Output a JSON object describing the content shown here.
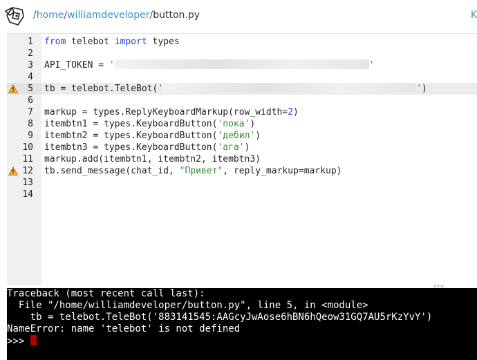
{
  "header": {
    "path_prefix": "/",
    "path_home": "home",
    "path_sep1": "/",
    "path_user": "williamdeveloper",
    "path_sep2": "/",
    "path_file": "button.py",
    "corner_letter": "K"
  },
  "editor": {
    "lines": [
      {
        "n": "1",
        "parts": [
          {
            "t": "from",
            "c": "kw"
          },
          {
            "t": " telebot ",
            "c": ""
          },
          {
            "t": "import",
            "c": "kw"
          },
          {
            "t": " types",
            "c": ""
          }
        ]
      },
      {
        "n": "2",
        "parts": []
      },
      {
        "n": "3",
        "parts": [
          {
            "t": "API_TOKEN = ",
            "c": ""
          },
          {
            "t": "'",
            "c": "str"
          },
          {
            "t": "[redacted]",
            "c": "redact",
            "w": 368
          },
          {
            "t": "'",
            "c": "str"
          }
        ]
      },
      {
        "n": "4",
        "parts": []
      },
      {
        "n": "5",
        "warn": true,
        "highlight": true,
        "parts": [
          {
            "t": "tb = telebot.TeleBot(",
            "c": ""
          },
          {
            "t": "'",
            "c": "str"
          },
          {
            "t": "[redacted]",
            "c": "redact",
            "w": 366
          },
          {
            "t": "'",
            "c": "str"
          },
          {
            "t": ")",
            "c": ""
          }
        ]
      },
      {
        "n": "6",
        "parts": []
      },
      {
        "n": "7",
        "parts": [
          {
            "t": "markup = types.ReplyKeyboardMarkup(row_width=",
            "c": ""
          },
          {
            "t": "2",
            "c": "num-lit"
          },
          {
            "t": ")",
            "c": ""
          }
        ]
      },
      {
        "n": "8",
        "parts": [
          {
            "t": "itembtn1 = types.KeyboardButton(",
            "c": ""
          },
          {
            "t": "'пока'",
            "c": "str"
          },
          {
            "t": ")",
            "c": ""
          }
        ]
      },
      {
        "n": "9",
        "parts": [
          {
            "t": "itembtn2 = types.KeyboardButton(",
            "c": ""
          },
          {
            "t": "'дебил'",
            "c": "str"
          },
          {
            "t": ")",
            "c": ""
          }
        ]
      },
      {
        "n": "10",
        "parts": [
          {
            "t": "itembtn3 = types.KeyboardButton(",
            "c": ""
          },
          {
            "t": "'ага'",
            "c": "str"
          },
          {
            "t": ")",
            "c": ""
          }
        ]
      },
      {
        "n": "11",
        "parts": [
          {
            "t": "markup.add(itembtn1, itembtn2, itembtn3)",
            "c": ""
          }
        ]
      },
      {
        "n": "12",
        "warn": true,
        "parts": [
          {
            "t": "tb.send_message(chat_id, ",
            "c": ""
          },
          {
            "t": "\"Привет\"",
            "c": "str"
          },
          {
            "t": ", reply_markup=markup)",
            "c": ""
          }
        ]
      },
      {
        "n": "13",
        "parts": []
      },
      {
        "n": "14",
        "parts": []
      }
    ]
  },
  "console": {
    "lines": [
      "Traceback (most recent call last):",
      "  File \"/home/williamdeveloper/button.py\", line 5, in <module>",
      "    tb = telebot.TeleBot('883141545:AAGcyJwAose6hBN6hQeow31GQ7AU5rKzYvY')",
      "NameError: name 'telebot' is not defined"
    ],
    "prompt": ">>> "
  },
  "colors": {
    "keyword": "#1e3fd6",
    "string": "#2f8f2f",
    "gutter": "#f0f0f0",
    "highlight": "#ececec",
    "console_bg": "#000000",
    "cursor": "#b10000",
    "path_link": "#3a8fc9"
  },
  "icons": {
    "logo": "pythonanywhere-logo-icon",
    "warning": "warning-triangle-icon"
  }
}
